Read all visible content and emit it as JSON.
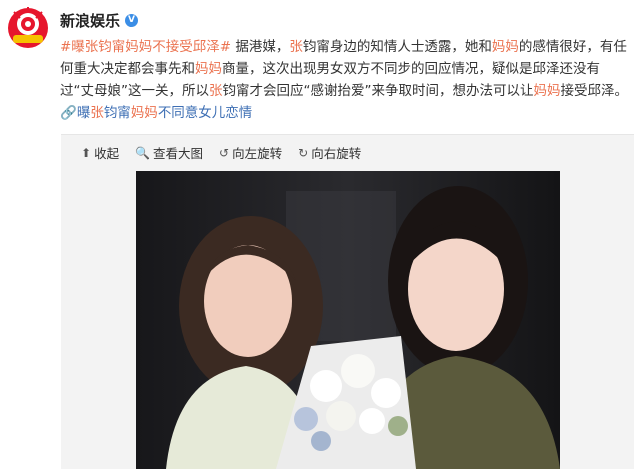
{
  "account": {
    "name": "新浪娱乐",
    "verified_icon": "verified-badge-icon"
  },
  "post": {
    "segments": [
      {
        "text": "#曝张钧甯妈妈不接受邱泽#",
        "style": "link"
      },
      {
        "text": " 据港媒，",
        "style": "plain"
      },
      {
        "text": "张",
        "style": "hl"
      },
      {
        "text": "钧甯身边的知情人士透露，她和",
        "style": "plain"
      },
      {
        "text": "妈妈",
        "style": "hl"
      },
      {
        "text": "的感情很好，有任何重大决定都会事先和",
        "style": "plain"
      },
      {
        "text": "妈妈",
        "style": "hl"
      },
      {
        "text": "商量，这次出现男女双方不同步的回应情况，疑似是邱泽还没有过“丈母娘”这一关，所以",
        "style": "plain"
      },
      {
        "text": "张",
        "style": "hl"
      },
      {
        "text": "钧甯才会回应“感谢抬爱”来争取时间，想办法可以让",
        "style": "plain"
      },
      {
        "text": "妈妈",
        "style": "hl"
      },
      {
        "text": "接受邱泽。",
        "style": "plain"
      },
      {
        "text": "🔗",
        "style": "extlink"
      },
      {
        "text": "曝",
        "style": "blue"
      },
      {
        "text": "张",
        "style": "hl"
      },
      {
        "text": "钧甯",
        "style": "blue"
      },
      {
        "text": "妈妈",
        "style": "hl"
      },
      {
        "text": "不同意女儿恋情",
        "style": "blue"
      }
    ]
  },
  "toolbar": {
    "collapse": "收起",
    "view_large": "查看大图",
    "rotate_left": "向左旋转",
    "rotate_right": "向右旋转"
  },
  "colors": {
    "accent": "#eb7350",
    "link_blue": "#3e6fb4",
    "verified_blue": "#3b8ee6"
  }
}
